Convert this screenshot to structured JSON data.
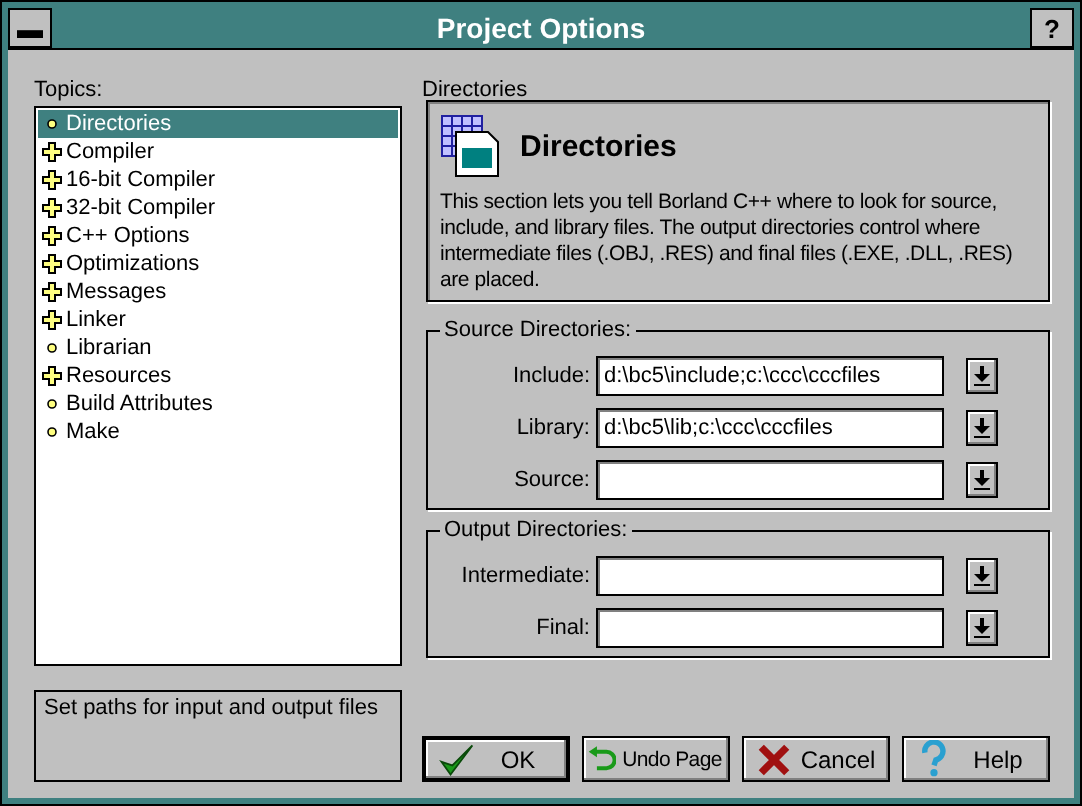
{
  "window": {
    "title": "Project Options",
    "menu_button": "▬",
    "help_button": "?"
  },
  "topics": {
    "label": "Topics:",
    "items": [
      {
        "label": "Directories",
        "kind": "leaf",
        "selected": true
      },
      {
        "label": "Compiler",
        "kind": "branch",
        "selected": false
      },
      {
        "label": "16-bit Compiler",
        "kind": "branch",
        "selected": false
      },
      {
        "label": "32-bit Compiler",
        "kind": "branch",
        "selected": false
      },
      {
        "label": "C++ Options",
        "kind": "branch",
        "selected": false
      },
      {
        "label": "Optimizations",
        "kind": "branch",
        "selected": false
      },
      {
        "label": "Messages",
        "kind": "branch",
        "selected": false
      },
      {
        "label": "Linker",
        "kind": "branch",
        "selected": false
      },
      {
        "label": "Librarian",
        "kind": "leaf",
        "selected": false
      },
      {
        "label": "Resources",
        "kind": "branch",
        "selected": false
      },
      {
        "label": "Build Attributes",
        "kind": "leaf",
        "selected": false
      },
      {
        "label": "Make",
        "kind": "leaf",
        "selected": false
      }
    ]
  },
  "hint": "Set paths for input and output files",
  "page": {
    "label": "Directories",
    "heading": "Directories",
    "description": "This section lets you tell Borland C++ where to look for source, include, and library files.  The output directories control where intermediate files (.OBJ, .RES) and final files (.EXE, .DLL, .RES) are placed."
  },
  "groups": [
    {
      "title": "Source Directories:",
      "fields": [
        {
          "label": "Include:",
          "value": "d:\\bc5\\include;c:\\ccc\\cccfiles"
        },
        {
          "label": "Library:",
          "value": "d:\\bc5\\lib;c:\\ccc\\cccfiles"
        },
        {
          "label": "Source:"
        }
      ]
    },
    {
      "title": "Output Directories:",
      "fields": [
        {
          "label": "Intermediate:"
        },
        {
          "label": "Final:"
        }
      ]
    }
  ],
  "buttons": [
    {
      "label": "OK",
      "kind": "ok",
      "default": true
    },
    {
      "label": "Undo Page",
      "kind": "undo",
      "default": false
    },
    {
      "label": "Cancel",
      "kind": "cancel",
      "default": false
    },
    {
      "label": "Help",
      "kind": "help",
      "default": false
    }
  ]
}
